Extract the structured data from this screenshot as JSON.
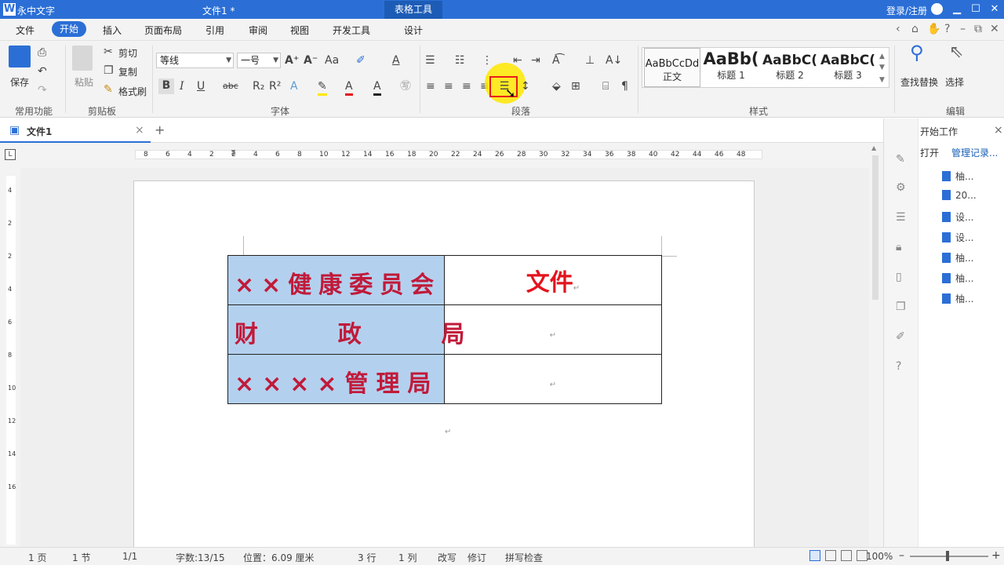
{
  "titlebar": {
    "app_name": "永中文字",
    "doc_name": "文件1 *",
    "context_tab": "表格工具",
    "login": "登录/注册",
    "min": "▁",
    "restore": "☐",
    "close": "✕"
  },
  "menus": [
    "文件",
    "开始",
    "插入",
    "页面布局",
    "引用",
    "审阅",
    "视图",
    "开发工具",
    "设计"
  ],
  "menubar_icons": [
    "‹",
    "⌂",
    "✋",
    "?",
    "–",
    "⧉",
    "✕"
  ],
  "ribbon": {
    "save": "保存",
    "cut": "剪切",
    "copy": "复制",
    "format_painter": "格式刷",
    "paste": "粘贴",
    "group_common": "常用功能",
    "group_clipboard": "剪贴板",
    "group_font": "字体",
    "group_paragraph": "段落",
    "group_styles": "样式",
    "group_edit": "编辑",
    "font_name": "等线",
    "font_size": "一号",
    "styles": [
      {
        "preview": "AaBbCcDd",
        "name": "正文"
      },
      {
        "preview": "AaBb(",
        "name": "标题 1"
      },
      {
        "preview": "AaBbC(",
        "name": "标题 2"
      },
      {
        "preview": "AaBbC(",
        "name": "标题 3"
      }
    ],
    "find_replace": "查找替换",
    "select": "选择"
  },
  "tab": {
    "name": "文件1",
    "add": "+"
  },
  "taskpane": {
    "title": "开始工作",
    "open": "打开",
    "manage": "管理记录...",
    "recent": [
      "柚...",
      "20...",
      "设...",
      "设...",
      "柚...",
      "柚...",
      "柚..."
    ]
  },
  "ruler_ticks": [
    "8",
    "6",
    "4",
    "2",
    "2",
    "4",
    "6",
    "8",
    "10",
    "12",
    "14",
    "16",
    "18",
    "20",
    "22",
    "24",
    "26",
    "28",
    "30",
    "32",
    "34",
    "36",
    "38",
    "40",
    "42",
    "44",
    "46",
    "48"
  ],
  "vruler_ticks": [
    "4",
    "2",
    "2",
    "4",
    "6",
    "8",
    "10",
    "12",
    "14",
    "16"
  ],
  "table": [
    {
      "left": "××健康委员会",
      "right": "文件"
    },
    {
      "left": "财    政    局",
      "right": ""
    },
    {
      "left": "××××管理局",
      "right": ""
    }
  ],
  "status": {
    "page": "1 页",
    "section": "1 节",
    "pages": "1/1",
    "words": "字数:13/15",
    "position": "位置：6.09 厘米",
    "row": "3 行",
    "col": "1 列",
    "overwrite": "改写",
    "revise": "修订",
    "spell": "拼写检查",
    "zoom": "100%"
  }
}
